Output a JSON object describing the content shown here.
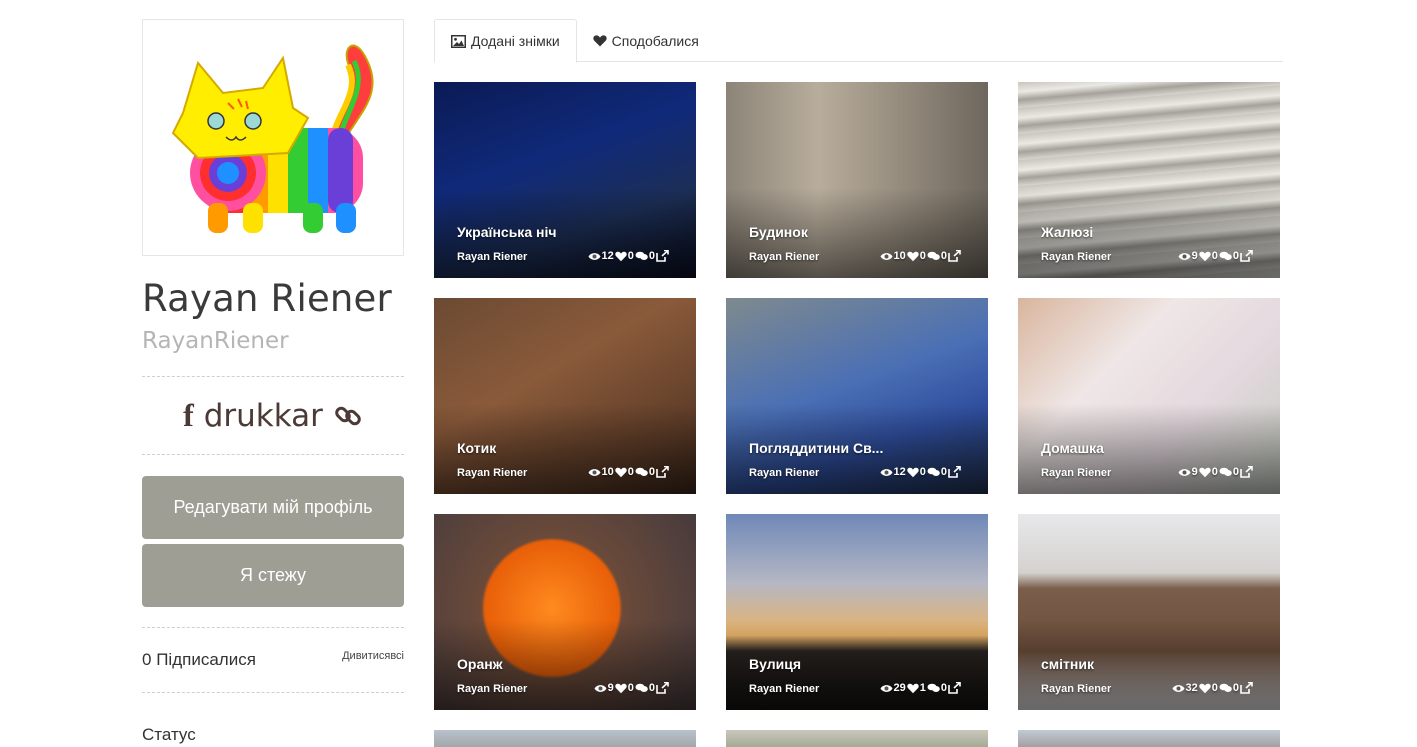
{
  "profile": {
    "name": "Rayan Riener",
    "username": "RayanRiener",
    "social_handle": "drukkar",
    "edit_button": "Редагувати мій профіль",
    "follow_button": "Я стежу",
    "subscribers_count": "0",
    "subscribers_label": "Підписалися",
    "subscribers_link": "Дивитисявсі",
    "status_label": "Статус"
  },
  "tabs": [
    {
      "label": "Додані знімки",
      "icon": "image-icon",
      "active": true
    },
    {
      "label": "Сподобалися",
      "icon": "heart-icon",
      "active": false
    }
  ],
  "photos": [
    {
      "title": "Українська ніч",
      "author": "Rayan Riener",
      "views": "12",
      "likes": "0",
      "comments": "0"
    },
    {
      "title": "Будинок",
      "author": "Rayan Riener",
      "views": "10",
      "likes": "0",
      "comments": "0"
    },
    {
      "title": "Жалюзі",
      "author": "Rayan Riener",
      "views": "9",
      "likes": "0",
      "comments": "0"
    },
    {
      "title": "Котик",
      "author": "Rayan Riener",
      "views": "10",
      "likes": "0",
      "comments": "0"
    },
    {
      "title": "Погляддитини Св...",
      "author": "Rayan Riener",
      "views": "12",
      "likes": "0",
      "comments": "0"
    },
    {
      "title": "Домашка",
      "author": "Rayan Riener",
      "views": "9",
      "likes": "0",
      "comments": "0"
    },
    {
      "title": "Оранж",
      "author": "Rayan Riener",
      "views": "9",
      "likes": "0",
      "comments": "0"
    },
    {
      "title": "Вулиця",
      "author": "Rayan Riener",
      "views": "29",
      "likes": "1",
      "comments": "0"
    },
    {
      "title": "смітник",
      "author": "Rayan Riener",
      "views": "32",
      "likes": "0",
      "comments": "0"
    }
  ]
}
